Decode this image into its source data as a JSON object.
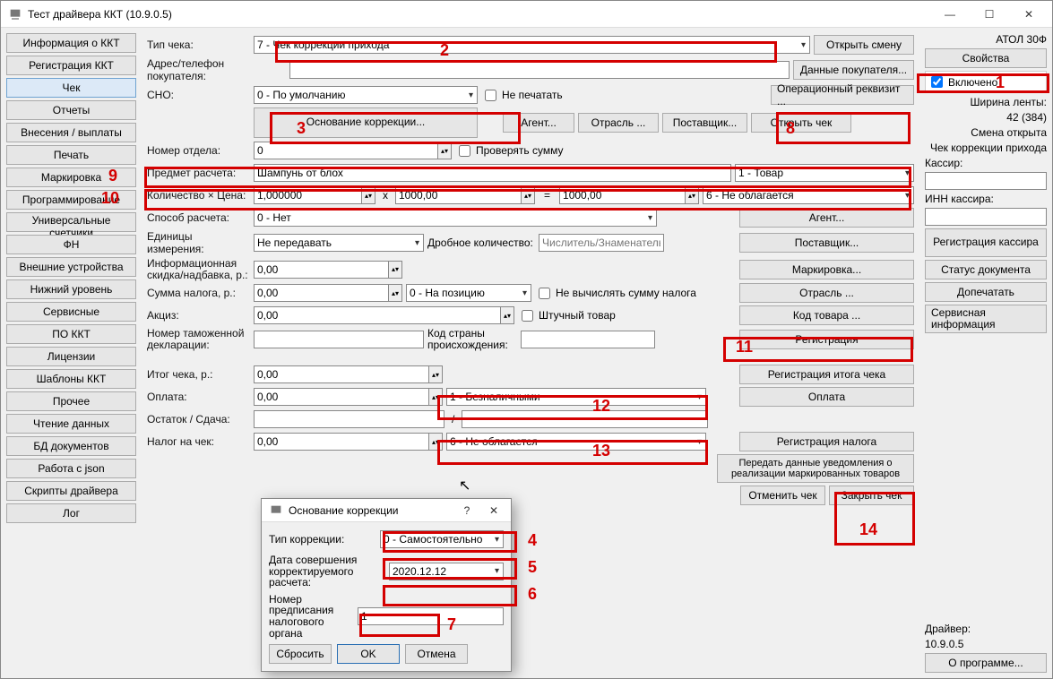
{
  "window": {
    "title": "Тест драйвера ККТ (10.9.0.5)"
  },
  "sidebar": {
    "items": [
      "Информация о ККТ",
      "Регистрация ККТ",
      "Чек",
      "Отчеты",
      "Внесения / выплаты",
      "Печать",
      "Маркировка",
      "Программирование",
      "Универсальные счетчики",
      "ФН",
      "Внешние устройства",
      "Нижний уровень",
      "Сервисные",
      "ПО ККТ",
      "Лицензии",
      "Шаблоны ККТ",
      "Прочее",
      "Чтение данных",
      "БД документов",
      "Работа с json",
      "Скрипты драйвера",
      "Лог"
    ],
    "active_index": 2
  },
  "form": {
    "check_type_label": "Тип чека:",
    "check_type_value": "7 - Чек коррекции прихода",
    "addr_label": "Адрес/телефон покупателя:",
    "addr_value": "",
    "sno_label": "СНО:",
    "sno_value": "0 - По умолчанию",
    "ne_pechatat": "Не печатать",
    "open_shift": "Открыть смену",
    "customer_data": "Данные покупателя...",
    "op_rekv": "Операционный реквизит ...",
    "correction_base": "Основание коррекции...",
    "agent_btn": "Агент...",
    "otrasl_btn": "Отрасль ...",
    "supplier_btn": "Поставщик...",
    "open_check": "Открыть чек",
    "dept_label": "Номер отдела:",
    "dept_value": "0",
    "check_sum": "Проверять сумму",
    "subj_label": "Предмет расчета:",
    "subj_value": "Шампунь от блох",
    "subj_type": "1 - Товар",
    "qty_label": "Количество × Цена:",
    "qty_value": "1,000000",
    "price_value": "1000,00",
    "eq": "=",
    "total_value": "1000,00",
    "tax_combo": "6 - Не облагается",
    "pay_method_label": "Способ расчета:",
    "pay_method_value": "0 - Нет",
    "agent_btn2": "Агент...",
    "units_label": "Единицы измерения:",
    "units_value": "Не передавать",
    "frac_label": "Дробное количество:",
    "frac_placeholder": "Числитель/Знаменатель",
    "supplier_btn2": "Поставщик...",
    "discount_label": "Информационная скидка/надбавка, р.:",
    "discount_value": "0,00",
    "marking_btn": "Маркировка...",
    "tax_sum_label": "Сумма налога, р.:",
    "tax_sum_value": "0,00",
    "tax_pos": "0 - На позицию",
    "no_calc_tax": "Не вычислять сумму налога",
    "otrasl_btn2": "Отрасль ...",
    "excise_label": "Акциз:",
    "excise_value": "0,00",
    "piece_good": "Штучный товар",
    "good_code_btn": "Код товара ...",
    "decl_label": "Номер таможенной декларации:",
    "decl_value": "",
    "country_label": "Код страны происхождения:",
    "country_value": "",
    "register_btn": "Регистрация",
    "check_total_label": "Итог чека, р.:",
    "check_total_value": "0,00",
    "reg_total_btn": "Регистрация итога чека",
    "payment_label": "Оплата:",
    "payment_value": "0,00",
    "payment_type": "1 - Безналичными",
    "payment_btn": "Оплата",
    "remain_label": "Остаток / Сдача:",
    "remain_a": "",
    "remain_b": "",
    "check_tax_label": "Налог на чек:",
    "check_tax_value": "0,00",
    "check_tax_type": "6 - Не облагается",
    "reg_tax_btn": "Регистрация налога",
    "send_mark": "Передать данные уведомления о реализации маркированных товаров",
    "cancel_check": "Отменить чек",
    "close_check": "Закрыть чек"
  },
  "right": {
    "device": "АТОЛ 30Ф",
    "properties": "Свойства",
    "enabled": "Включено",
    "tape_width_label": "Ширина ленты:",
    "tape_width_value": "42 (384)",
    "shift_state": "Смена открыта",
    "mode": "Чек коррекции прихода",
    "cashier_label": "Кассир:",
    "cashier_value": "",
    "cashier_inn_label": "ИНН кассира:",
    "cashier_inn_value": "",
    "reg_cashier": "Регистрация кассира",
    "doc_status": "Статус документа",
    "reprint": "Допечатать",
    "service_info": "Сервисная информация",
    "driver_label": "Драйвер:",
    "driver_ver": "10.9.0.5",
    "about": "О программе..."
  },
  "dialog": {
    "title": "Основание коррекции",
    "type_label": "Тип коррекции:",
    "type_value": "0 - Самостоятельно",
    "date_label": "Дата совершения корректируемого расчета:",
    "date_value": "2020.12.12",
    "doc_label": "Номер предписания налогового органа",
    "doc_value": "1",
    "reset": "Сбросить",
    "ok": "OK",
    "cancel": "Отмена"
  },
  "annotations": {
    "n1": "1",
    "n2": "2",
    "n3": "3",
    "n4": "4",
    "n5": "5",
    "n6": "6",
    "n7": "7",
    "n8": "8",
    "n9": "9",
    "n10": "10",
    "n11": "11",
    "n12": "12",
    "n13": "13",
    "n14": "14"
  }
}
